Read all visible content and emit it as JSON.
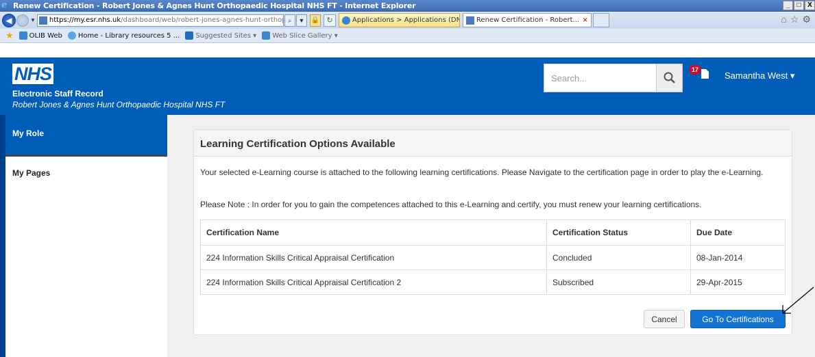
{
  "window": {
    "title": "Renew Certification - Robert Jones & Agnes Hunt Orthopaedic Hospital NHS FT - Internet Explorer",
    "controls": [
      "_",
      "□",
      "X"
    ]
  },
  "browser": {
    "address_host": "https://my.esr.nhs.uk",
    "address_path": "/dashboard/web/robert-jones-agnes-hunt-orthopaedic-hospital-nhs-ft,",
    "tabs": [
      {
        "label": "Applications > Applications (DN...",
        "active": false
      },
      {
        "label": "Renew Certification - Robert...",
        "active": true
      }
    ],
    "tab_close": "×"
  },
  "favorites": {
    "items": [
      {
        "label": "OLIB Web",
        "dim": false
      },
      {
        "label": "Home - Library resources 5 ...",
        "dim": false
      },
      {
        "label": "Suggested Sites ▾",
        "dim": true
      },
      {
        "label": "Web Slice Gallery ▾",
        "dim": true
      }
    ]
  },
  "header": {
    "logo": "NHS",
    "app_name": "Electronic Staff Record",
    "org_name": "Robert Jones & Agnes Hunt Orthopaedic Hospital NHS FT",
    "search_placeholder": "Search...",
    "notification_count": "17",
    "user_name": "Samantha West ▾"
  },
  "sidebar": {
    "items": [
      {
        "label": "My Role",
        "active": true
      },
      {
        "label": "My Pages",
        "active": false
      }
    ]
  },
  "panel": {
    "title": "Learning Certification Options Available",
    "intro": "Your selected e-Learning course is attached to the following learning certifications. Please Navigate to the certification page in order to play the e-Learning.",
    "note": "Please Note : In order for you to gain the competences attached to this e-Learning and certify, you must renew your learning certifications.",
    "columns": [
      "Certification Name",
      "Certification Status",
      "Due Date"
    ],
    "rows": [
      {
        "name": "224 Information Skills Critical Appraisal Certification",
        "status": "Concluded",
        "due": "08-Jan-2014"
      },
      {
        "name": "224 Information Skills Critical Appraisal Certification 2",
        "status": "Subscribed",
        "due": "29-Apr-2015"
      }
    ],
    "cancel_label": "Cancel",
    "go_label": "Go To Certifications"
  },
  "colors": {
    "nhs_blue": "#005eb8",
    "primary_button": "#1473d3",
    "badge": "#c8102e"
  }
}
